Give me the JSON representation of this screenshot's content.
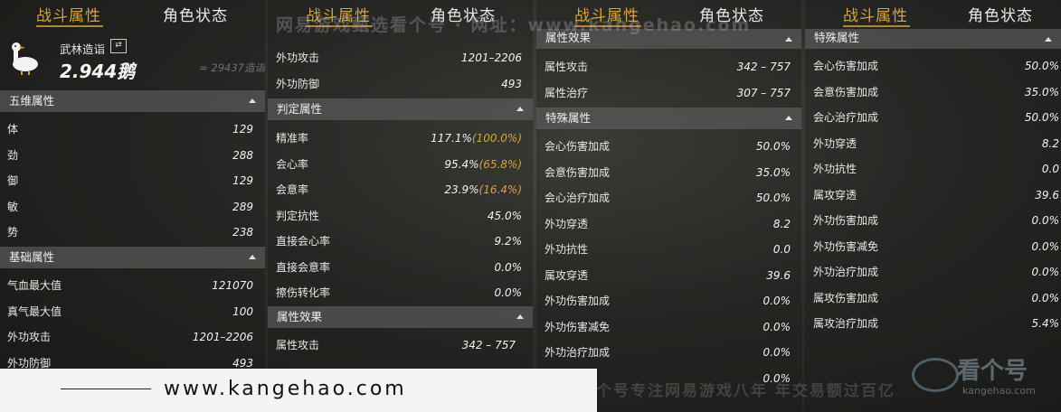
{
  "tabs": {
    "combat": "战斗属性",
    "status": "角色状态"
  },
  "profile": {
    "title": "武林造诣",
    "geese": "2.944鹅",
    "approx": "≈ 29437造诣",
    "swap_icon": "⇄"
  },
  "watermarks": {
    "top": "网易游戏甄选看个号 · 网址：www.kangehao.com",
    "bottom": "看个号专注网易游戏八年  年交易额过百亿"
  },
  "banner": {
    "url": "www.kangehao.com"
  },
  "logo": {
    "text": "看个号",
    "sub": "kangehao.com"
  },
  "colors": {
    "accent": "#d9a33c"
  },
  "panel1": {
    "sec_five": "五维属性",
    "five": [
      {
        "label": "体",
        "value": "129"
      },
      {
        "label": "劲",
        "value": "288"
      },
      {
        "label": "御",
        "value": "129"
      },
      {
        "label": "敏",
        "value": "289"
      },
      {
        "label": "势",
        "value": "238"
      }
    ],
    "sec_base": "基础属性",
    "base": [
      {
        "label": "气血最大值",
        "value": "121070"
      },
      {
        "label": "真气最大值",
        "value": "100"
      },
      {
        "label": "外功攻击",
        "value": "1201–2206"
      },
      {
        "label": "外功防御",
        "value": "493"
      }
    ]
  },
  "panel2": {
    "top_rows": [
      {
        "label": "外功攻击",
        "value": "1201–2206"
      },
      {
        "label": "外功防御",
        "value": "493"
      }
    ],
    "sec_judge": "判定属性",
    "judge": [
      {
        "label": "精准率",
        "value": "117.1%",
        "hl": "(100.0%)"
      },
      {
        "label": "会心率",
        "value": "95.4%",
        "hl": "(65.8%)"
      },
      {
        "label": "会意率",
        "value": "23.9%",
        "hl": "(16.4%)"
      },
      {
        "label": "判定抗性",
        "value": "45.0%",
        "hl": ""
      },
      {
        "label": "直接会心率",
        "value": "9.2%",
        "hl": ""
      },
      {
        "label": "直接会意率",
        "value": "0.0%",
        "hl": ""
      },
      {
        "label": "擦伤转化率",
        "value": "0.0%",
        "hl": ""
      }
    ],
    "sec_effect": "属性效果",
    "effect": [
      {
        "label": "属性攻击",
        "value": "342 – 757"
      }
    ]
  },
  "panel3": {
    "sec_effect": "属性效果",
    "effect": [
      {
        "label": "属性攻击",
        "value": "342 – 757"
      },
      {
        "label": "属性治疗",
        "value": "307 – 757"
      }
    ],
    "sec_special": "特殊属性",
    "special": [
      {
        "label": "会心伤害加成",
        "value": "50.0%"
      },
      {
        "label": "会意伤害加成",
        "value": "35.0%"
      },
      {
        "label": "会心治疗加成",
        "value": "50.0%"
      },
      {
        "label": "外功穿透",
        "value": "8.2"
      },
      {
        "label": "外功抗性",
        "value": "0.0"
      },
      {
        "label": "属攻穿透",
        "value": "39.6"
      },
      {
        "label": "外功伤害加成",
        "value": "0.0%"
      },
      {
        "label": "外功伤害减免",
        "value": "0.0%"
      },
      {
        "label": "外功治疗加成",
        "value": "0.0%"
      },
      {
        "label": "",
        "value": "0.0%"
      }
    ]
  },
  "panel4": {
    "sec_special": "特殊属性",
    "special": [
      {
        "label": "会心伤害加成",
        "value": "50.0%"
      },
      {
        "label": "会意伤害加成",
        "value": "35.0%"
      },
      {
        "label": "会心治疗加成",
        "value": "50.0%"
      },
      {
        "label": "外功穿透",
        "value": "8.2"
      },
      {
        "label": "外功抗性",
        "value": "0.0"
      },
      {
        "label": "属攻穿透",
        "value": "39.6"
      },
      {
        "label": "外功伤害加成",
        "value": "0.0%"
      },
      {
        "label": "外功伤害减免",
        "value": "0.0%"
      },
      {
        "label": "外功治疗加成",
        "value": "0.0%"
      },
      {
        "label": "属攻伤害加成",
        "value": "0.0%"
      },
      {
        "label": "属攻治疗加成",
        "value": "5.4%"
      }
    ]
  }
}
